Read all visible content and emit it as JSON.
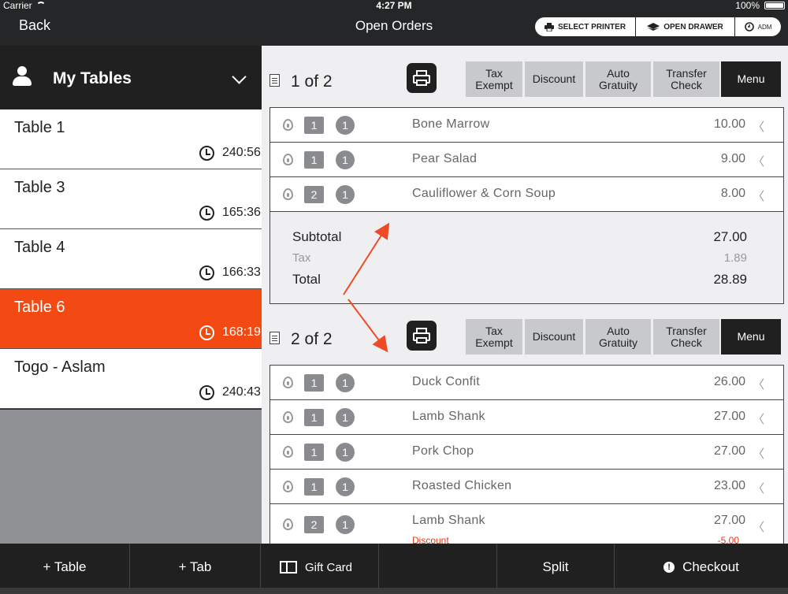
{
  "status": {
    "carrier": "Carrier",
    "time": "4:27 PM",
    "battery": "100%"
  },
  "nav": {
    "back": "Back",
    "title": "Open Orders"
  },
  "device_buttons": [
    {
      "label": "SELECT PRINTER",
      "icon": "printer-icon"
    },
    {
      "label": "OPEN DRAWER",
      "icon": "drawer-icon"
    },
    {
      "label": "ADM",
      "icon": "clock-icon"
    }
  ],
  "tables_header": {
    "title": "My Tables",
    "icon": "person-icon"
  },
  "tables": [
    {
      "name": "Table 1",
      "time": "240:56",
      "selected": false
    },
    {
      "name": "Table 3",
      "time": "165:36",
      "selected": false
    },
    {
      "name": "Table 4",
      "time": "166:33",
      "selected": false
    },
    {
      "name": "Table 6",
      "time": "168:19",
      "selected": true
    },
    {
      "name": "Togo - Aslam",
      "time": "240:43",
      "selected": false
    }
  ],
  "action_buttons": [
    "Tax Exempt",
    "Discount",
    "Auto Gratuity",
    "Transfer Check",
    "Menu"
  ],
  "checks": [
    {
      "label": "1 of 2",
      "items": [
        {
          "seat": "1",
          "qty": "1",
          "name": "Bone Marrow",
          "price": "10.00"
        },
        {
          "seat": "1",
          "qty": "1",
          "name": "Pear Salad",
          "price": "9.00"
        },
        {
          "seat": "2",
          "qty": "1",
          "name": "Cauliflower & Corn Soup",
          "price": "8.00"
        }
      ],
      "subtotal_label": "Subtotal",
      "subtotal": "27.00",
      "tax_label": "Tax",
      "tax": "1.89",
      "total_label": "Total",
      "total": "28.89"
    },
    {
      "label": "2 of 2",
      "items": [
        {
          "seat": "1",
          "qty": "1",
          "name": "Duck Confit",
          "price": "26.00"
        },
        {
          "seat": "1",
          "qty": "1",
          "name": "Lamb Shank",
          "price": "27.00"
        },
        {
          "seat": "1",
          "qty": "1",
          "name": "Pork Chop",
          "price": "27.00"
        },
        {
          "seat": "1",
          "qty": "1",
          "name": "Roasted Chicken",
          "price": "23.00"
        },
        {
          "seat": "2",
          "qty": "1",
          "name": "Lamb Shank",
          "price": "27.00",
          "discount_label": "Discount",
          "discount": "-5.00"
        }
      ]
    }
  ],
  "bottom": {
    "add_table": "+ Table",
    "add_tab": "+ Tab",
    "gift_card": "Gift Card",
    "split": "Split",
    "checkout": "Checkout"
  },
  "colors": {
    "accent": "#f34a14",
    "dark": "#202021",
    "arrow": "#ef4a26"
  }
}
